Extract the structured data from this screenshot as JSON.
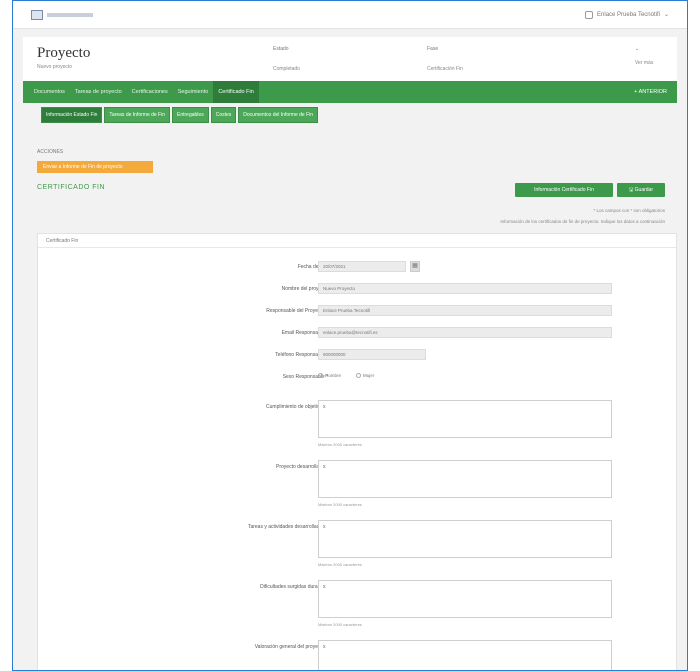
{
  "header": {
    "user_label": "Enlace Prueba Tecnotifi"
  },
  "project": {
    "title": "Proyecto",
    "subtitle": "Nuevo proyecto",
    "meta": [
      {
        "label": "Estado",
        "value": "Completado"
      },
      {
        "label": "Fase",
        "value": "Certificación Fin"
      },
      {
        "label": "",
        "value": "Ver más"
      }
    ]
  },
  "nav": {
    "items": [
      "Documentos",
      "Tareas de proyecto",
      "Certificaciones",
      "Seguimiento",
      "Certificado Fin"
    ],
    "active_index": 4,
    "right_label": "+ ANTERIOR"
  },
  "subnav": {
    "items": [
      "Información Estado Fin",
      "Tareas de Informe de Fin",
      "Entregables",
      "Costes",
      "Documentos del Informe de Fin"
    ],
    "active_index": 0
  },
  "actions": {
    "section_label": "ACCIONES",
    "orange_button": "Enviar a Informe de Fin de proyecto"
  },
  "certificate": {
    "title": "CERTIFICADO FIN",
    "btn_primary": "Información Certificado Fin",
    "btn_secondary": "Guardar",
    "note1": "* Los campos con * son obligatorios",
    "note2": "Información de los certificados de fin de proyecto. Indique los datos a continuación"
  },
  "form": {
    "card_title": "Certificado Fin",
    "fields": [
      {
        "label": "Fecha de alta",
        "value": "20/07/2021"
      },
      {
        "label": "Nombre del proyecto",
        "value": "Nuevo Proyecto"
      },
      {
        "label": "Responsable del Proyecto *",
        "value": "Enlace Prueba Tecnotifi"
      },
      {
        "label": "Email Responsable *",
        "value": "enlace.prueba@tecnotifi.es"
      },
      {
        "label": "Teléfono Responsable *",
        "value": "900000000"
      }
    ],
    "sexo": {
      "label": "Sexo Responsable *",
      "options": [
        "Hombre",
        "Mujer"
      ]
    },
    "textareas": [
      {
        "label": "Cumplimiento de objetivos *",
        "value": "x",
        "hint": "Máximo 2000 caracteres"
      },
      {
        "label": "Proyecto desarrollado *",
        "value": "x",
        "hint": "Máximo 2000 caracteres"
      },
      {
        "label": "Tareas y actividades desarrolladas *",
        "value": "x",
        "hint": "Máximo 2000 caracteres"
      },
      {
        "label": "Dificultades surgidas durante *",
        "value": "x",
        "hint": "Máximo 2000 caracteres"
      },
      {
        "label": "Valoración general del proyecto *",
        "value": "x",
        "hint": ""
      }
    ]
  }
}
